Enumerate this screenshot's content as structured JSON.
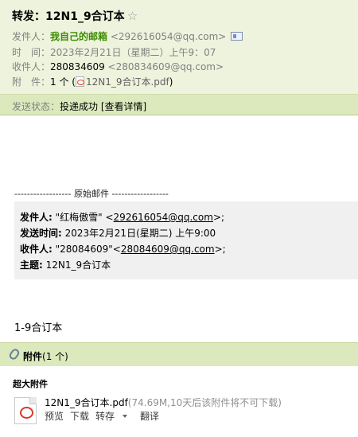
{
  "mail": {
    "subject": "转发：12N1_9合订本",
    "star": "☆",
    "from_label": "发件人：",
    "from_name": "我自己的邮箱",
    "from_email": "<292616054@qq.com>",
    "time_label": "时　间：",
    "time_value": "2023年2月21日（星期二）上午9：07",
    "to_label": "收件人：",
    "to_name": "280834609",
    "to_email": "<280834609@qq.com>",
    "att_label": "附　件：",
    "att_count": "1 个 (",
    "att_file": "12N1_9合订本.pdf",
    "att_close": ")"
  },
  "status": {
    "label": "发送状态：",
    "value": "投递成功",
    "detail_link": "[查看详情]"
  },
  "original": {
    "separator": "------------------ 原始邮件 ------------------",
    "from_label": "发件人:",
    "from_value": " \"红梅傲雪\" <",
    "from_email": "292616054@qq.com",
    "from_tail": ">;",
    "date_label": "发送时间:",
    "date_value": " 2023年2月21日(星期二) 上午9:00",
    "to_label": "收件人:",
    "to_value": " \"28084609\"<",
    "to_email": "28084609@qq.com",
    "to_tail": ">;",
    "subject_label": "主题:",
    "subject_value": " 12N1_9合订本"
  },
  "body_text": "1-9合订本",
  "attachments": {
    "header_label": "附件",
    "header_count": "(1 个)",
    "section_title": "超大附件",
    "file_name": "12N1_9合订本.pdf",
    "file_info": "(74.69M,10天后该附件将不可下载)",
    "actions": {
      "preview": "预览",
      "download": "下载",
      "save": "转存",
      "translate": "翻译"
    }
  }
}
